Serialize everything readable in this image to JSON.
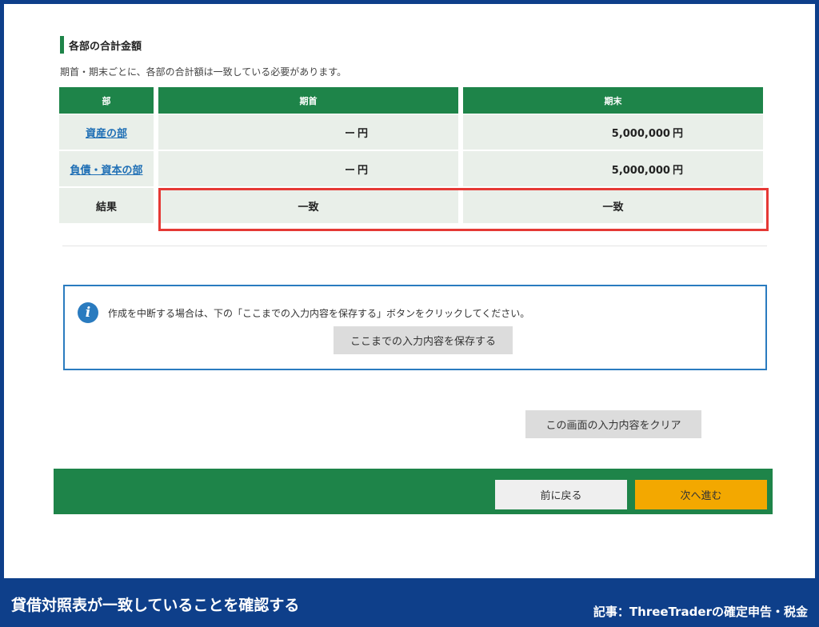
{
  "section": {
    "title": "各部の合計金額",
    "description": "期首・期末ごとに、各部の合計額は一致している必要があります。"
  },
  "table": {
    "headers": [
      "部",
      "期首",
      "期末"
    ],
    "rows": [
      {
        "dept": "資産の部",
        "start": "ー",
        "start_unit": "円",
        "end": "5,000,000",
        "end_unit": "円"
      },
      {
        "dept": "負債・資本の部",
        "start": "ー",
        "start_unit": "円",
        "end": "5,000,000",
        "end_unit": "円"
      }
    ],
    "result": {
      "label": "結果",
      "start": "一致",
      "end": "一致"
    }
  },
  "info": {
    "message": "作成を中断する場合は、下の「ここまでの入力内容を保存する」ボタンをクリックしてください。",
    "save_label": "ここまでの入力内容を保存する"
  },
  "clear_label": "この画面の入力内容をクリア",
  "nav": {
    "back_label": "前に戻る",
    "next_label": "次へ進む"
  },
  "caption": {
    "left": "貸借対照表が一致していることを確認する",
    "right": "記事：ThreeTraderの確定申告・税金"
  },
  "colors": {
    "brand_green": "#1e8449",
    "frame_blue": "#0e3f8a",
    "highlight_red": "#e53935",
    "next_orange": "#f3a800"
  }
}
